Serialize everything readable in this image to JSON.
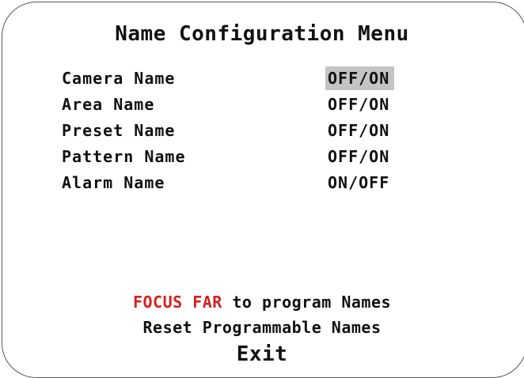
{
  "menu": {
    "title": "Name Configuration Menu",
    "items": [
      {
        "label": "Camera Name",
        "value": "OFF/ON",
        "selected": true
      },
      {
        "label": "Area Name",
        "value": "OFF/ON",
        "selected": false
      },
      {
        "label": "Preset Name",
        "value": "OFF/ON",
        "selected": false
      },
      {
        "label": "Pattern Name",
        "value": "OFF/ON",
        "selected": false
      },
      {
        "label": "Alarm Name",
        "value": "ON/OFF",
        "selected": false
      }
    ]
  },
  "footer": {
    "focus_key": "FOCUS FAR",
    "focus_text": " to program Names",
    "reset_label": "Reset Programmable Names",
    "exit_label": "Exit"
  },
  "colors": {
    "highlight": "#c4c4c4",
    "focus_key": "#d42020",
    "text": "#111111"
  }
}
